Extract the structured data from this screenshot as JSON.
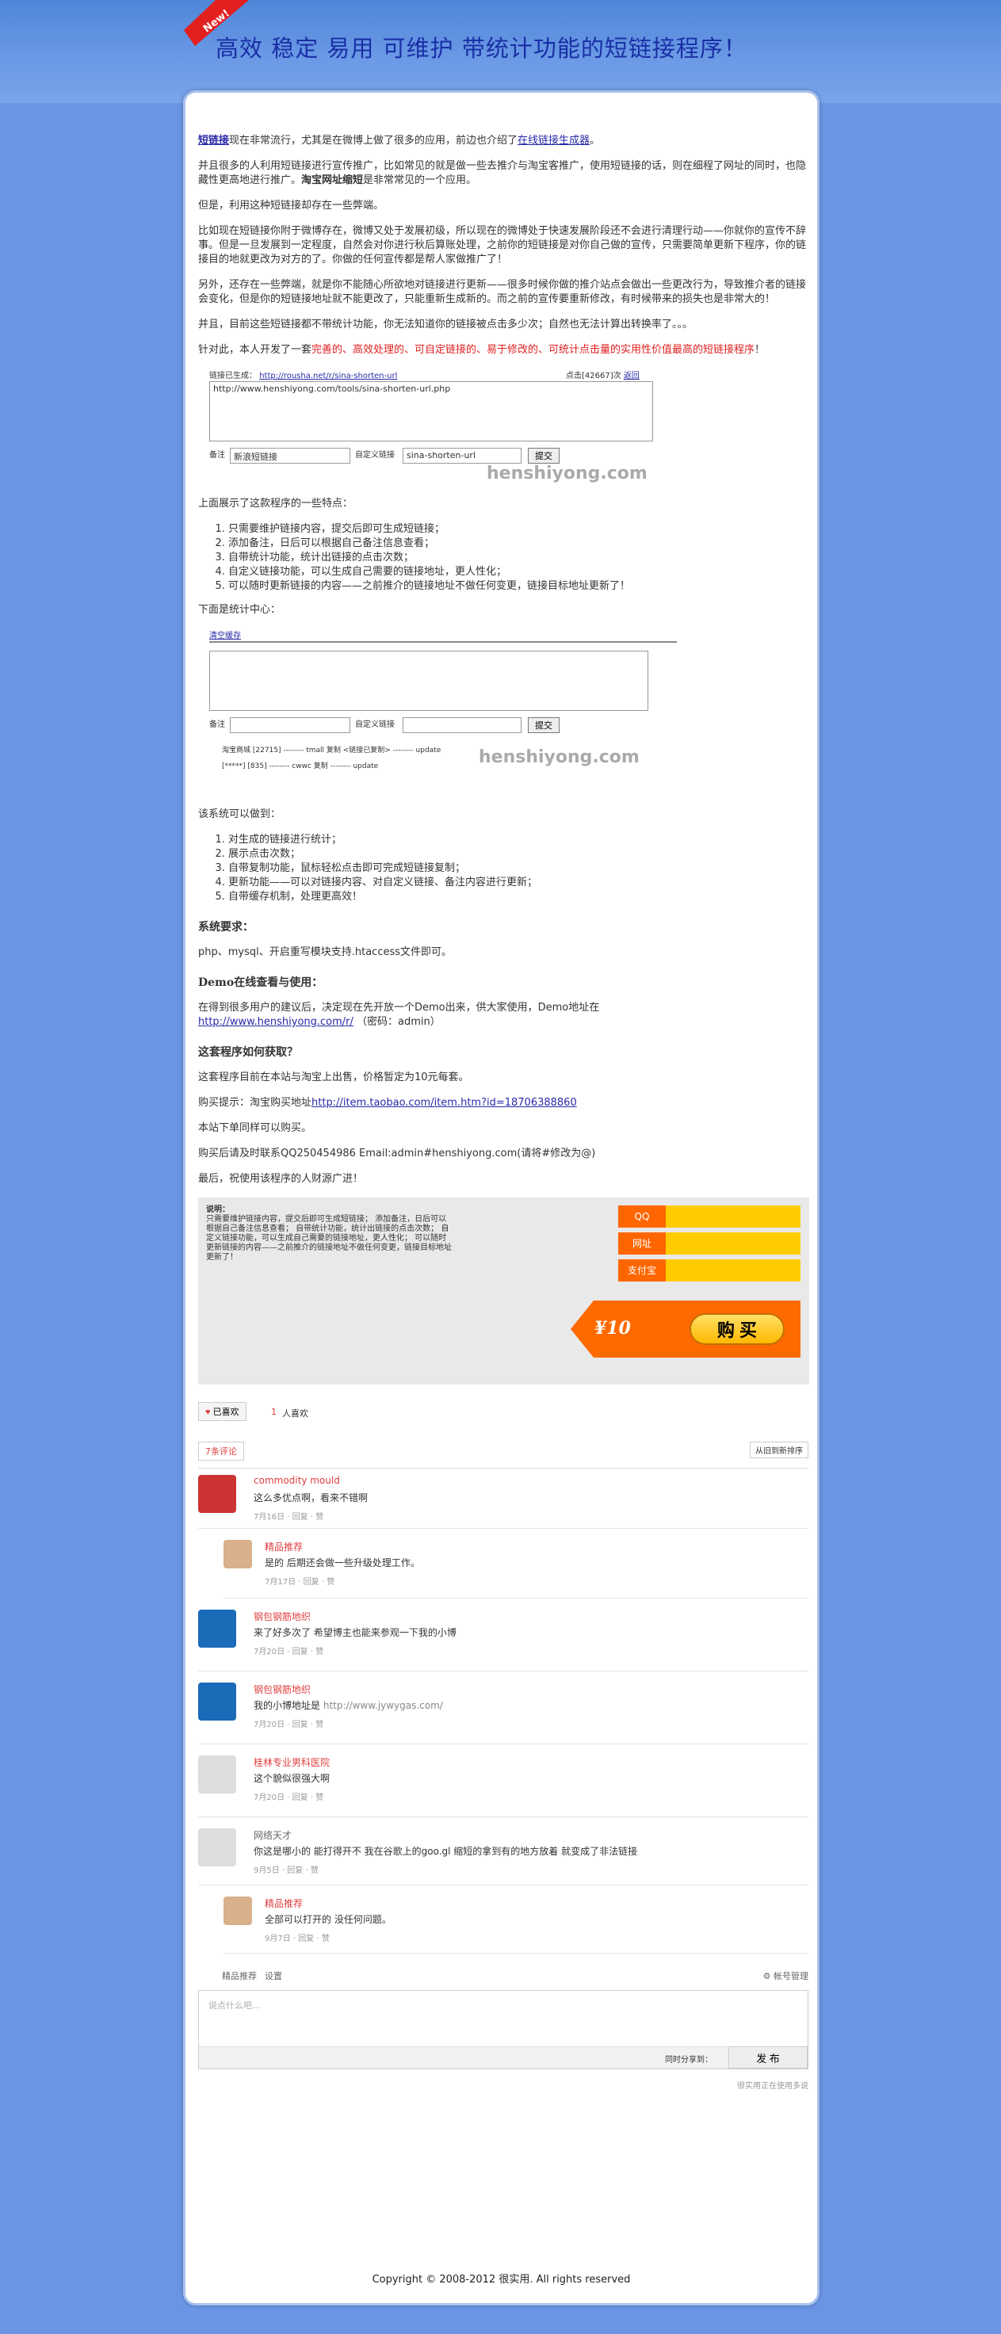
{
  "header": {
    "badge": "New!",
    "title": "高效 稳定 易用 可维护 带统计功能的短链接程序！"
  },
  "article": {
    "p1_link": "短链接",
    "p1_text": "现在非常流行，尤其是在微博上做了很多的应用，前边也介绍了",
    "p1_link2": "在线链接生成器",
    "p1_end": "。",
    "p2": "并且很多的人利用短链接进行宣传推广，比如常见的就是做一些去推介与淘宝客推广，使用短链接的话，则在细程了网址的同时，也隐藏性更高地进行推广。",
    "p2_bold": "淘宝网址缩短",
    "p2_end": "是非常常见的一个应用。",
    "p3": "但是，利用这种短链接却存在一些弊端。",
    "p4": "比如现在短链接你附于微博存在，微博又处于发展初级，所以现在的微博处于快速发展阶段还不会进行清理行动——你就你的宣传不辞事。但是一旦发展到一定程度，自然会对你进行秋后算账处理，之前你的短链接是对你自己做的宣传，只需要简单更新下程序，你的链接目的地就更改为对方的了。你做的任何宣传都是帮人家做推广了！",
    "p5": "另外，还存在一些弊端，就是你不能随心所欲地对链接进行更新——很多时候你做的推介站点会做出一些更改行为，导致推介者的链接会变化，但是你的短链接地址就不能更改了，只能重新生成新的。而之前的宣传要重新修改，有时候带来的损失也是非常大的！",
    "p6": "并且，目前这些短链接都不带统计功能，你无法知道你的链接被点击多少次；自然也无法计算出转换率了。。。",
    "p7_a": "针对此，本人开发了一套",
    "p7_red": "完善的、高效处理的、可自定链接的、易于修改的、可统计点击量的实用性价值最高的短链接程序",
    "p7_end": "！",
    "demo1": {
      "label": "链接已生成：",
      "url": "http://rousha.net/r/sina-shorten-url",
      "count": "点击[42667]次",
      "back": "返回",
      "textarea": "http://www.henshiyong.com/tools/sina-shorten-url.php",
      "note_label": "备注",
      "note_value": "新浪短链接",
      "custom_label": "自定义链接",
      "custom_value": "sina-shorten-url",
      "submit": "提交",
      "watermark": "henshiyong.com"
    },
    "p8": "上面展示了这款程序的一些特点：",
    "features": [
      "只需要维护链接内容，提交后即可生成短链接；",
      "添加备注，日后可以根据自己备注信息查看；",
      "自带统计功能，统计出链接的点击次数；",
      "自定义链接功能，可以生成自己需要的链接地址，更人性化；",
      "可以随时更新链接的内容——之前推介的链接地址不做任何变更，链接目标地址更新了！"
    ],
    "p9": "下面是统计中心：",
    "demo2": {
      "tab": "清空缓存",
      "note_label": "备注",
      "custom_label": "自定义链接",
      "submit": "提交",
      "row1": "淘宝商城 [22715] -------- tmall 复制 <链接已复制> -------- update",
      "row2": "[*****] [835] -------- cwwc 复制 -------- update",
      "watermark": "henshiyong.com"
    },
    "p10": "该系统可以做到：",
    "features2": [
      "对生成的链接进行统计；",
      "展示点击次数；",
      "自带复制功能，鼠标轻松点击即可完成短链接复制；",
      "更新功能——可以对链接内容、对自定义链接、备注内容进行更新；",
      "自带缓存机制，处理更高效！"
    ],
    "h_req": "系统要求：",
    "req": "php、mysql、开启重写模块支持.htaccess文件即可。",
    "h_demo": "Demo在线查看与使用：",
    "demo_p": "在得到很多用户的建议后，决定现在先开放一个Demo出来，供大家使用，Demo地址在",
    "demo_link": "http://www.henshiyong.com/r/",
    "demo_pwd": "（密码：admin）",
    "h_get": "这套程序如何获取？",
    "get1": "这套程序目前在本站与淘宝上出售，价格暂定为10元每套。",
    "get2_text": "购买提示：淘宝购买地址",
    "get2_link": "http://item.taobao.com/item.htm?id=18706388860",
    "get3": "本站下单同样可以购买。",
    "get4": "购买后请及时联系QQ250454986 Email:admin#henshiyong.com(请将#修改为@)",
    "get5": "最后，祝使用该程序的人财源广进！"
  },
  "buy": {
    "desc_title": "说明：",
    "desc": "只需要维护链接内容，提交后即可生成短链接； 添加备注，日后可以根据自己备注信息查看； 自带统计功能，统计出链接的点击次数； 自定义链接功能，可以生成自己需要的链接地址，更人性化； 可以随时更新链接的内容——之前推介的链接地址不做任何变更，链接目标地址更新了！",
    "rows": [
      "QQ",
      "网址",
      "支付宝"
    ],
    "price": "¥10",
    "button": "购 买"
  },
  "likes": {
    "button": "已喜欢",
    "count": "1",
    "text": "人喜欢"
  },
  "comments_bar": {
    "count": "7条评论",
    "sort": "从旧到新排序"
  },
  "comments": [
    {
      "name": "commodity mould",
      "text": "这么多优点啊，看来不错啊",
      "date": "7月16日",
      "reply": "回复",
      "like": "赞"
    },
    {
      "name": "精品推荐",
      "text": "是的 后期还会做一些升级处理工作。",
      "date": "7月17日",
      "reply": "回复",
      "like": "赞"
    },
    {
      "name": "钢包钢筋地织",
      "text": "来了好多次了 希望博主也能来参观一下我的小博",
      "date": "7月20日",
      "reply": "回复",
      "like": "赞"
    },
    {
      "name": "钢包钢筋地织",
      "text": "我的小博地址是",
      "link": "http://www.jywygas.com/",
      "date": "7月20日",
      "reply": "回复",
      "like": "赞"
    },
    {
      "name": "桂林专业男科医院",
      "text": "这个貌似很强大啊",
      "date": "7月20日",
      "reply": "回复",
      "like": "赞"
    },
    {
      "name": "网络天才",
      "text": "你这是哪小的 能打得开不 我在谷歌上的goo.gl 缩短的拿到有的地方放着 就变成了非法链接",
      "date": "9月5日",
      "reply": "回复",
      "like": "赞"
    },
    {
      "name": "精品推荐",
      "text": "全部可以打开的 没任何问题。",
      "date": "9月7日",
      "reply": "回复",
      "like": "赞"
    }
  ],
  "compose": {
    "user": "精品推荐",
    "settings": "设置",
    "account": "帐号管理",
    "placeholder": "说点什么吧...",
    "share": "同时分享到：",
    "publish": "发 布",
    "footer_link": "很实用正在使用多说"
  },
  "footer": "Copyright © 2008-2012 很实用. All rights reserved",
  "colors": {
    "accent": "#ff6600",
    "link": "#2929a8",
    "red": "#e02020"
  }
}
